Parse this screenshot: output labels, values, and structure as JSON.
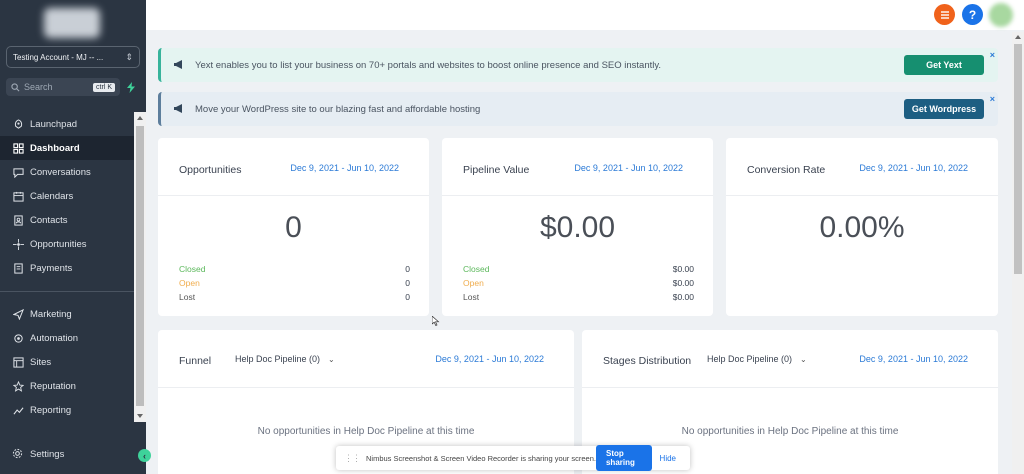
{
  "sidebar": {
    "account_name": "Testing Account - MJ -- ...",
    "search_placeholder": "Search",
    "search_shortcut": "ctrl K",
    "items_top": [
      {
        "label": "Launchpad",
        "icon": "rocket-icon"
      },
      {
        "label": "Dashboard",
        "icon": "grid-icon",
        "active": true
      },
      {
        "label": "Conversations",
        "icon": "chat-icon"
      },
      {
        "label": "Calendars",
        "icon": "calendar-icon"
      },
      {
        "label": "Contacts",
        "icon": "contacts-icon"
      },
      {
        "label": "Opportunities",
        "icon": "opportunities-icon"
      },
      {
        "label": "Payments",
        "icon": "payments-icon"
      }
    ],
    "items_bottom": [
      {
        "label": "Marketing",
        "icon": "send-icon"
      },
      {
        "label": "Automation",
        "icon": "automation-icon"
      },
      {
        "label": "Sites",
        "icon": "globe-icon"
      },
      {
        "label": "Reputation",
        "icon": "star-icon"
      },
      {
        "label": "Reporting",
        "icon": "chart-icon"
      }
    ],
    "settings_label": "Settings"
  },
  "banners": {
    "yext": {
      "text": "Yext enables you to list your business on 70+ portals and websites to boost online presence and SEO instantly.",
      "button": "Get Yext",
      "close": "×"
    },
    "wordpress": {
      "text": "Move your WordPress site to our blazing fast and affordable hosting",
      "button": "Get Wordpress",
      "close": "×"
    }
  },
  "cards": {
    "opportunities": {
      "title": "Opportunities",
      "date": "Dec 9, 2021 - Jun 10, 2022",
      "value": "0",
      "rows": [
        {
          "label": "Closed",
          "value": "0"
        },
        {
          "label": "Open",
          "value": "0"
        },
        {
          "label": "Lost",
          "value": "0"
        }
      ]
    },
    "pipeline": {
      "title": "Pipeline Value",
      "date": "Dec 9, 2021 - Jun 10, 2022",
      "value": "$0.00",
      "rows": [
        {
          "label": "Closed",
          "value": "$0.00"
        },
        {
          "label": "Open",
          "value": "$0.00"
        },
        {
          "label": "Lost",
          "value": "$0.00"
        }
      ]
    },
    "conversion": {
      "title": "Conversion Rate",
      "date": "Dec 9, 2021 - Jun 10, 2022",
      "value": "0.00%"
    },
    "funnel": {
      "title": "Funnel",
      "pipeline": "Help Doc Pipeline (0)",
      "date": "Dec 9, 2021 - Jun 10, 2022",
      "empty": "No opportunities in Help Doc Pipeline at this time"
    },
    "stages": {
      "title": "Stages Distribution",
      "pipeline": "Help Doc Pipeline (0)",
      "date": "Dec 9, 2021 - Jun 10, 2022",
      "empty": "No opportunities in Help Doc Pipeline at this time"
    }
  },
  "topbar": {
    "help": "?"
  },
  "sharebar": {
    "message": "Nimbus Screenshot & Screen Video Recorder is sharing your screen.",
    "stop": "Stop sharing",
    "hide": "Hide"
  },
  "colors": {
    "sidebar_bg": "#2b3542",
    "accent_green": "#3ed29a",
    "link_blue": "#2b7ad6",
    "closed": "#5cb85c",
    "open": "#f0ad4e"
  }
}
